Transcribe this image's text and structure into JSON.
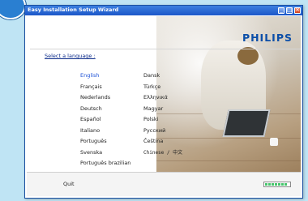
{
  "window": {
    "title": "Easy Installation Setup Wizard",
    "controls": [
      "minimize",
      "maximize",
      "close"
    ]
  },
  "brand": {
    "logo_text": "PHILIPS",
    "color": "#0b4ea8"
  },
  "language_select": {
    "label": "Select a language :",
    "selected": "English",
    "left_column": [
      "English",
      "Français",
      "Nederlands",
      "Deutsch",
      "Español",
      "Italiano",
      "Português",
      "Svenska",
      "Português brazilian"
    ],
    "right_column": [
      "Dansk",
      "Türkçe",
      "Ελληνικά",
      "Magyar",
      "Polski",
      "Русский",
      "Čeština",
      "Chinese / 中文"
    ]
  },
  "footer": {
    "quit_label": "Quit",
    "progress_fraction": 0.9
  },
  "colors": {
    "background": "#bfe4f4",
    "selected_language": "#1a4fd6",
    "progress": "#45c46b"
  }
}
